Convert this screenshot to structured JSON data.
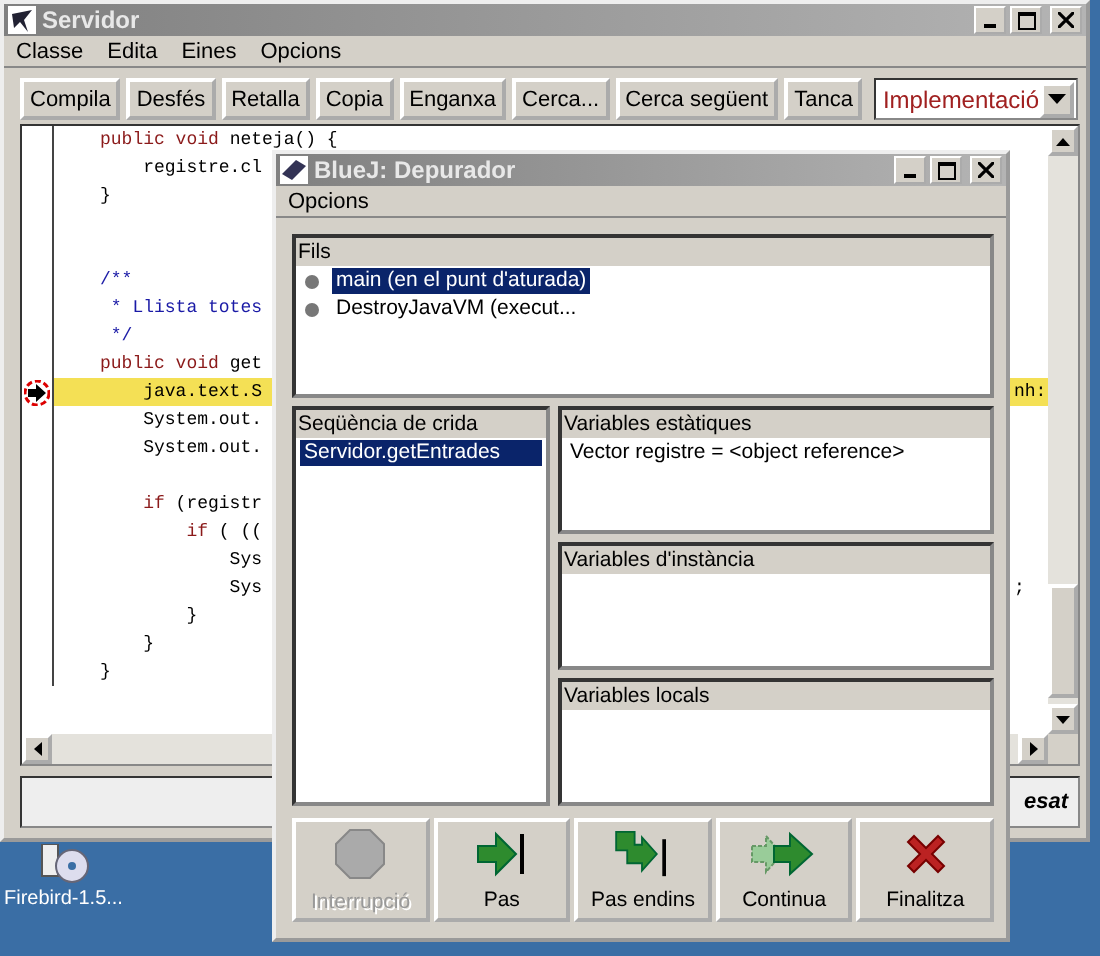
{
  "editor_window": {
    "title": "Servidor",
    "menu": [
      "Classe",
      "Edita",
      "Eines",
      "Opcions"
    ],
    "toolbar": [
      "Compila",
      "Desfés",
      "Retalla",
      "Copia",
      "Enganxa",
      "Cerca...",
      "Cerca següent",
      "Tanca"
    ],
    "view_selector": {
      "value": "Implementació"
    },
    "code": [
      {
        "segments": [
          {
            "kind": "keyword",
            "text": "public void"
          },
          {
            "kind": "plain",
            "text": " neteja() {"
          }
        ],
        "highlighted": false,
        "breakpoint": false
      },
      {
        "segments": [
          {
            "kind": "plain",
            "text": "    registre.cl"
          }
        ],
        "highlighted": false,
        "breakpoint": false
      },
      {
        "segments": [
          {
            "kind": "plain",
            "text": "}"
          }
        ],
        "highlighted": false,
        "breakpoint": false
      },
      {
        "highlighted": false,
        "breakpoint": false
      },
      {
        "highlighted": false,
        "breakpoint": false
      },
      {
        "segments": [
          {
            "kind": "comment",
            "text": "/**"
          }
        ],
        "highlighted": false,
        "breakpoint": false
      },
      {
        "segments": [
          {
            "kind": "comment",
            "text": " * Llista totes"
          }
        ],
        "highlighted": false,
        "breakpoint": false
      },
      {
        "segments": [
          {
            "kind": "comment",
            "text": " */"
          }
        ],
        "highlighted": false,
        "breakpoint": false
      },
      {
        "segments": [
          {
            "kind": "keyword",
            "text": "public void"
          },
          {
            "kind": "plain",
            "text": " get"
          }
        ],
        "highlighted": false,
        "breakpoint": false
      },
      {
        "segments": [
          {
            "kind": "plain",
            "text": "    java.text.S"
          }
        ],
        "right": "nh:",
        "highlighted": true,
        "breakpoint": true
      },
      {
        "segments": [
          {
            "kind": "plain",
            "text": "    System.out."
          }
        ],
        "highlighted": false,
        "breakpoint": false
      },
      {
        "segments": [
          {
            "kind": "plain",
            "text": "    System.out."
          }
        ],
        "highlighted": false,
        "breakpoint": false
      },
      {
        "highlighted": false,
        "breakpoint": false
      },
      {
        "segments": [
          {
            "kind": "keyword",
            "text": "    if"
          },
          {
            "kind": "plain",
            "text": " (registr"
          }
        ],
        "highlighted": false,
        "breakpoint": false
      },
      {
        "segments": [
          {
            "kind": "keyword",
            "text": "        if"
          },
          {
            "kind": "plain",
            "text": " ( (("
          }
        ],
        "highlighted": false,
        "breakpoint": false
      },
      {
        "segments": [
          {
            "kind": "plain",
            "text": "            Sys"
          }
        ],
        "highlighted": false,
        "breakpoint": false
      },
      {
        "segments": [
          {
            "kind": "plain",
            "text": "            Sys"
          }
        ],
        "right": ";",
        "highlighted": false,
        "breakpoint": false
      },
      {
        "segments": [
          {
            "kind": "plain",
            "text": "        }"
          }
        ],
        "highlighted": false,
        "breakpoint": false
      },
      {
        "segments": [
          {
            "kind": "plain",
            "text": "    }"
          }
        ],
        "highlighted": false,
        "breakpoint": false
      },
      {
        "segments": [
          {
            "kind": "plain",
            "text": "}"
          }
        ],
        "highlighted": false,
        "breakpoint": false
      }
    ],
    "status": "esat"
  },
  "debugger_window": {
    "title": "BlueJ: Depurador",
    "menu": [
      "Opcions"
    ],
    "threads": {
      "title": "Fils",
      "items": [
        {
          "label": "main (en el punt d'aturada)",
          "selected": true
        },
        {
          "label": "DestroyJavaVM (execut...",
          "selected": false
        }
      ]
    },
    "call_sequence": {
      "title": "Seqüència de crida",
      "items": [
        {
          "label": "Servidor.getEntrades",
          "selected": true
        }
      ]
    },
    "variable_panels": [
      {
        "title": "Variables estàtiques",
        "items": [
          "Vector registre = <object reference>"
        ]
      },
      {
        "title": "Variables d'instància"
      },
      {
        "title": "Variables locals"
      }
    ],
    "controls": [
      {
        "kind": "stop",
        "label": "Interrupció",
        "disabled": true
      },
      {
        "kind": "step",
        "label": "Pas",
        "disabled": false
      },
      {
        "kind": "step_into",
        "label": "Pas endins",
        "disabled": false
      },
      {
        "kind": "continue",
        "label": "Continua",
        "disabled": false
      },
      {
        "kind": "terminate",
        "label": "Finalitza",
        "disabled": false
      }
    ]
  },
  "desktop_icons": [
    {
      "label": "Firebird-1.5..."
    }
  ]
}
